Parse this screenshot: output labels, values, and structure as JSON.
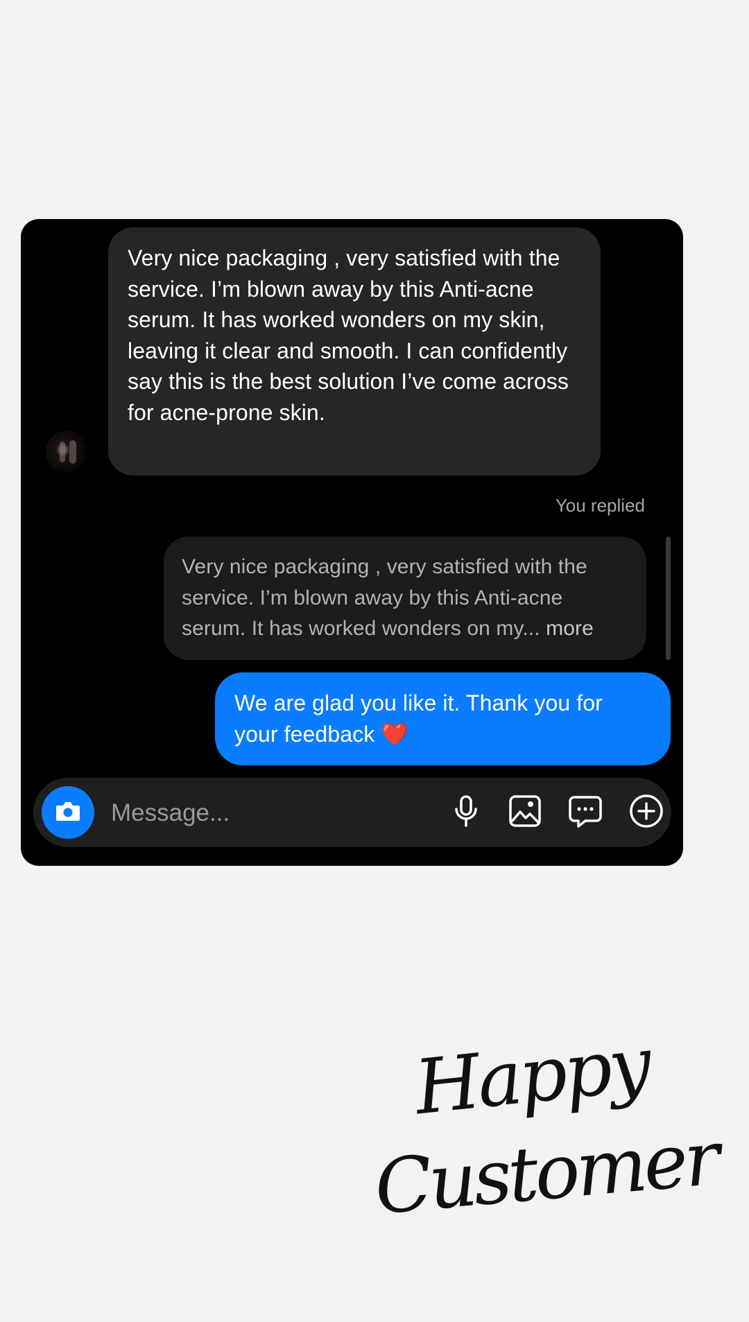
{
  "conversation": {
    "incoming_message": "Very nice packaging , very satisfied with the service. I’m blown away by this Anti-acne serum. It has worked wonders on my skin, leaving it clear and smooth. I can confidently say this is the best solution I’ve come across for acne-prone skin.",
    "replied_label": "You replied",
    "quoted_message": "Very nice packaging , very satisfied with the service. I’m blown away by this  Anti-acne serum. It has worked wonders on my...",
    "quoted_more": "more",
    "outgoing_message": "We are glad you like it. Thank you for your feedback",
    "outgoing_emoji": "❤️"
  },
  "composer": {
    "placeholder": "Message...",
    "icons": [
      "camera-icon",
      "microphone-icon",
      "gallery-icon",
      "sticker-chat-icon",
      "plus-icon"
    ]
  },
  "overlay": {
    "line1": "Happy",
    "line2": "Customer"
  },
  "colors": {
    "page_background": "#f2f2f3",
    "chat_background": "#000000",
    "incoming_bubble": "#262626",
    "outgoing_bubble": "#0a7cff",
    "accent": "#0a7cff"
  }
}
